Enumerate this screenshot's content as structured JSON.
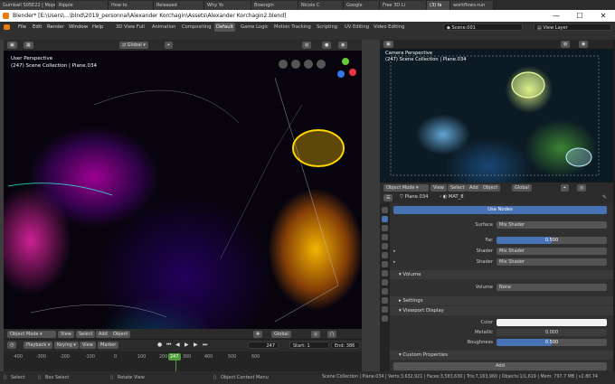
{
  "browser_tabs": [
    {
      "label": "Gumball S05E22 | Mopc",
      "active": false
    },
    {
      "label": "Ripple",
      "active": false
    },
    {
      "label": "How to",
      "active": false
    },
    {
      "label": "Released",
      "active": false
    },
    {
      "label": "Why Yo",
      "active": false
    },
    {
      "label": "Bioengin",
      "active": false
    },
    {
      "label": "Nicole C",
      "active": false
    },
    {
      "label": "Google",
      "active": false
    },
    {
      "label": "Free 3D Li",
      "active": false
    },
    {
      "label": "(3) fa",
      "active": true
    },
    {
      "label": "workflows-run",
      "active": false
    }
  ],
  "window": {
    "title": "Blender* [E:\\Users\\...\\blnd\\2019_personnal\\Alexander Korchagin\\Assets\\Alexander Korchagin2.blend]",
    "minimize": "—",
    "maximize": "☐",
    "close": "✕"
  },
  "topbar": {
    "menus": [
      "File",
      "Edit",
      "Render",
      "Window",
      "Help"
    ],
    "workspaces": [
      "3D View Full",
      "Animation",
      "Compositing",
      "Default",
      "Game Logic",
      "Motion Tracking",
      "Scripting",
      "UV Editing",
      "Video Editing"
    ],
    "active_workspace": "Default",
    "scene": "Scene.001",
    "view_layer": "View Layer"
  },
  "viewport": {
    "header": {
      "mode": "Object Mode",
      "menus": [
        "View",
        "Select",
        "Add",
        "Object"
      ],
      "transform": "Global"
    },
    "perspective": "User Perspective",
    "collection": "(247) Scene Collection | Plane.034",
    "footer": {
      "mode": "Object Mode",
      "menus": [
        "View",
        "Select",
        "Add",
        "Object"
      ],
      "transform": "Global"
    }
  },
  "camera_view": {
    "perspective": "Camera Perspective",
    "collection": "(247) Scene Collection | Plane.034",
    "footer": {
      "mode": "Object Mode",
      "menus": [
        "View",
        "Select",
        "Add",
        "Object"
      ],
      "transform": "Global"
    }
  },
  "timeline": {
    "menus": [
      "Playback",
      "Keying",
      "View",
      "Marker"
    ],
    "current_frame": "247",
    "start_label": "Start:",
    "start": "1",
    "end_label": "End:",
    "end": "386",
    "ticks": [
      "-400",
      "-300",
      "-200",
      "-100",
      "0",
      "100",
      "200",
      "247",
      "300",
      "400",
      "500",
      "600"
    ]
  },
  "properties": {
    "object": "Plane.034",
    "material": "MAT_8",
    "use_nodes": "Use Nodes",
    "surface_label": "Surface",
    "surface_value": "Mix Shader",
    "fac_label": "Fac",
    "fac_value": "0.500",
    "fac_fraction": 0.5,
    "shader_label": "Shader",
    "shader1_value": "Mix Shader",
    "shader2_value": "Mix Shader",
    "volume_section": "Volume",
    "volume_label": "Volume",
    "volume_value": "None",
    "settings_section": "Settings",
    "viewport_display_section": "Viewport Display",
    "color_label": "Color",
    "metallic_label": "Metallic",
    "metallic_value": "0.000",
    "roughness_label": "Roughness",
    "roughness_value": "0.500",
    "roughness_fraction": 0.5,
    "custom_properties_section": "Custom Properties",
    "add_label": "Add"
  },
  "statusbar": {
    "select": "Select",
    "box_select": "Box Select",
    "rotate_view": "Rotate View",
    "context_menu": "Object Context Menu",
    "stats": "Scene Collection | Plane.034 | Verts:3,632,921 | Faces:3,583,630 | Tris:7,163,960 | Objects:1/1,619 | Mem: 797.7 MB | v2.80.74"
  },
  "colors": {
    "accent": "#4772b3",
    "active_frame": "#4e9a3d",
    "gizmo_x": "#ee3344",
    "gizmo_y": "#66cc33",
    "gizmo_z": "#3377ee"
  }
}
